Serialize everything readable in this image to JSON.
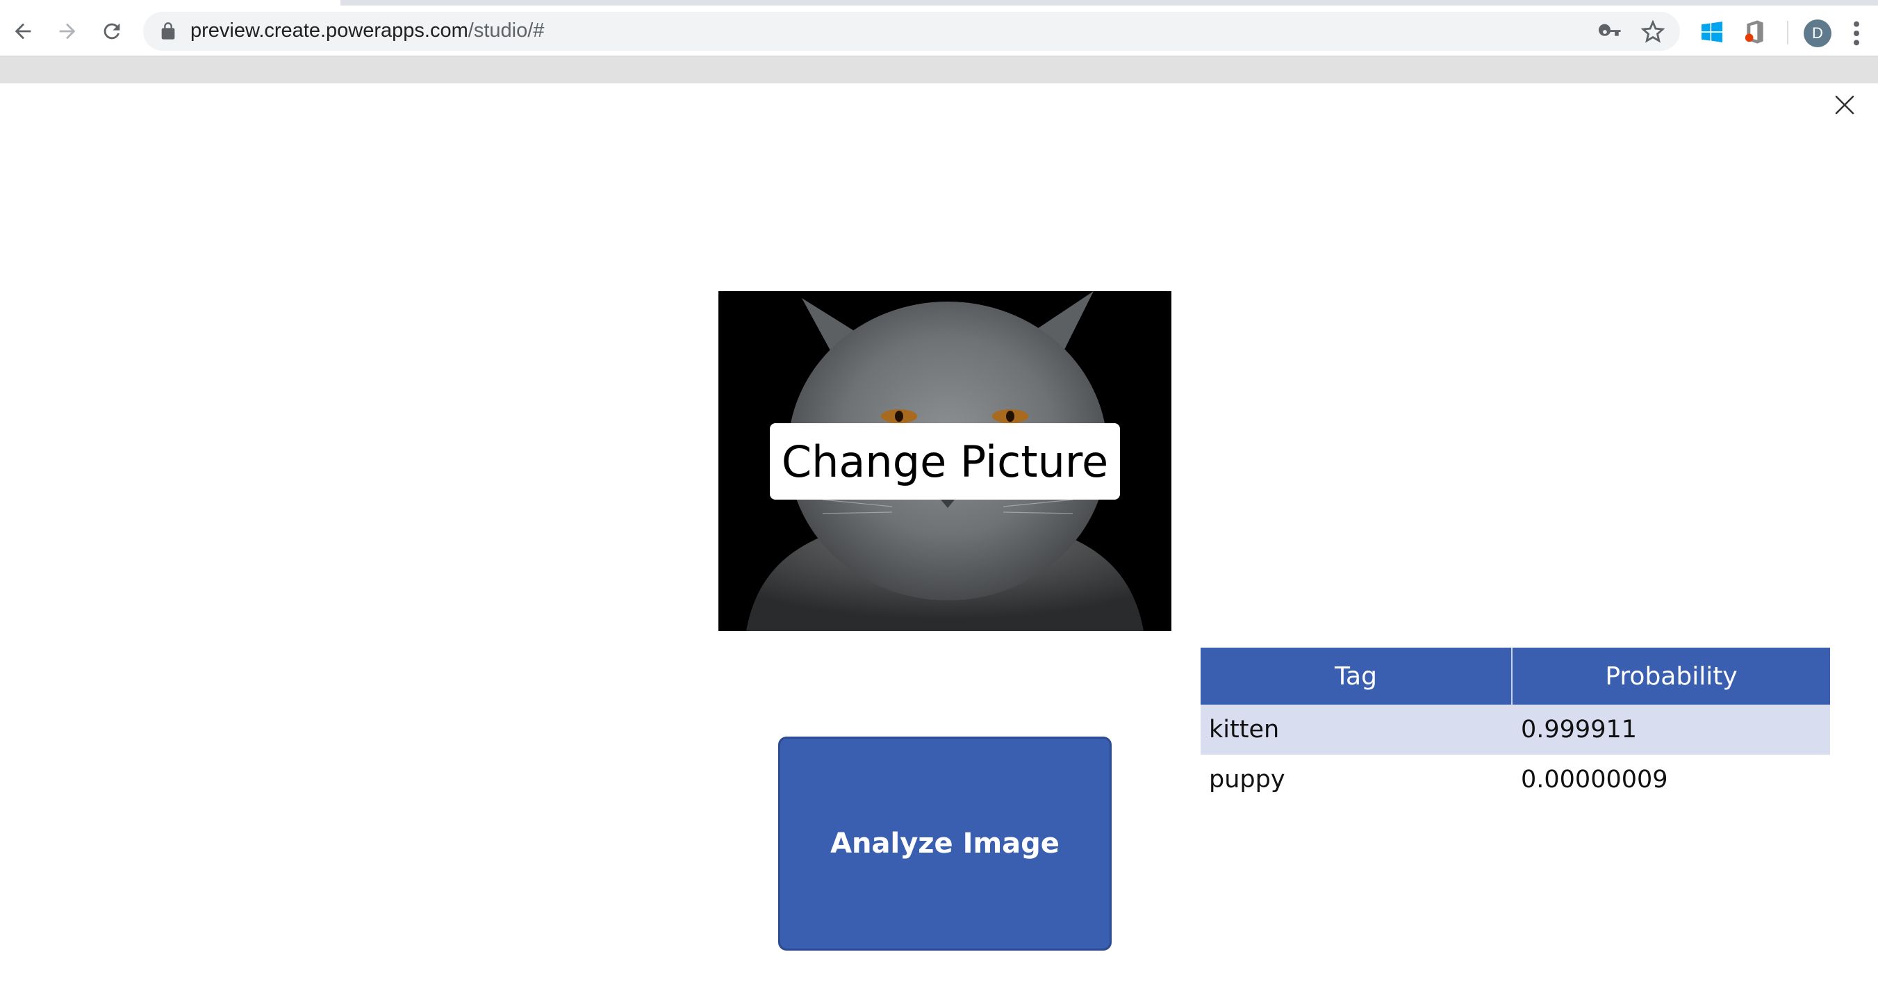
{
  "browser": {
    "url_host": "preview.create.powerapps.com",
    "url_path": "/studio/#",
    "profile_initial": "D"
  },
  "app": {
    "change_picture_label": "Change Picture",
    "analyze_button_label": "Analyze Image",
    "image_subject": "gray cat on black background",
    "results_table": {
      "columns": [
        "Tag",
        "Probability"
      ],
      "rows": [
        {
          "tag": "kitten",
          "probability": "0.999911",
          "selected": true
        },
        {
          "tag": "puppy",
          "probability": "0.00000009",
          "selected": false
        }
      ]
    }
  },
  "colors": {
    "primary": "#3a5fb0",
    "selected_row": "#d8deef"
  }
}
